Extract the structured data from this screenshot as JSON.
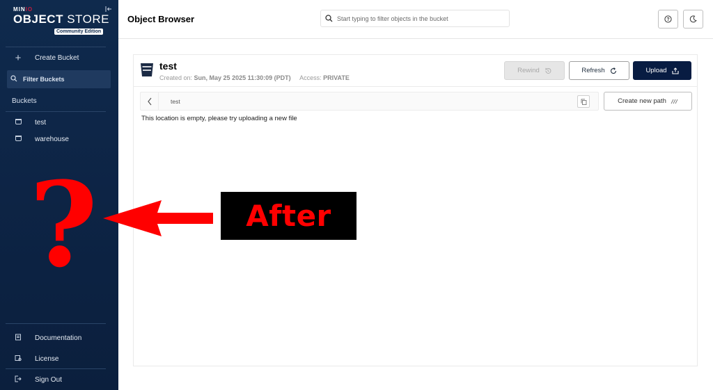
{
  "sidebar": {
    "logo_minio": "MIN",
    "logo_minio_accent": "IO",
    "logo_object": "OBJECT",
    "logo_store": " STORE",
    "logo_edition": "Community Edition",
    "create_bucket": "Create Bucket",
    "filter_buckets": "Filter Buckets",
    "buckets_label": "Buckets",
    "buckets": [
      "test",
      "warehouse"
    ],
    "bottom": {
      "documentation": "Documentation",
      "license": "License",
      "sign_out": "Sign Out"
    },
    "icons": [
      "collapse-icon",
      "plus-icon",
      "search-icon",
      "bucket-icon",
      "document-icon",
      "license-icon",
      "sign-out-icon"
    ]
  },
  "header": {
    "title": "Object Browser",
    "search_placeholder": "Start typing to filter objects in the bucket",
    "help_icon": "question-circle-icon",
    "theme_icon": "moon-icon"
  },
  "bucket": {
    "name": "test",
    "created_label": "Created on:",
    "created_value": "Sun, May 25 2025 11:30:09 (PDT)",
    "access_label": "Access:",
    "access_value": "PRIVATE",
    "rewind_label": "Rewind",
    "refresh_label": "Refresh",
    "upload_label": "Upload",
    "path": "test",
    "create_path_label": "Create new path",
    "empty_message": "This location is empty, please try uploading a new file"
  },
  "annotation": {
    "question_mark": "?",
    "after_label": "After",
    "color": "#ff0000"
  },
  "colors": {
    "sidebar_bg": "#0f2a4d",
    "upload_bg": "#081c42",
    "accent_red": "#c51c3f"
  }
}
